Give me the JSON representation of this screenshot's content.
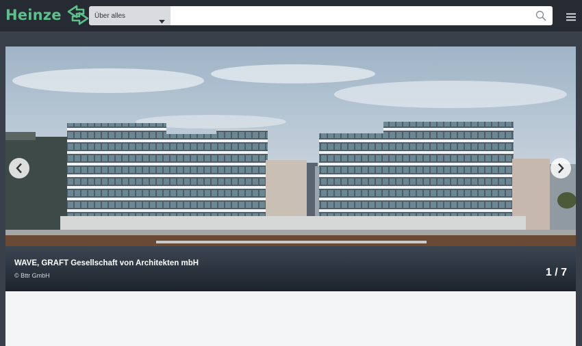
{
  "header": {
    "logo_text": "Heinze",
    "brand_color": "#5cc08a",
    "scope_select": {
      "selected": "Über alles"
    },
    "search": {
      "placeholder": "",
      "value": ""
    },
    "icons": [
      "heinze-logo-mark-icon",
      "chevron-down-icon",
      "search-icon",
      "hamburger-menu-icon"
    ]
  },
  "slider": {
    "caption": "WAVE, GRAFT Gesellschaft von Architekten mbH",
    "credit": "© Bttr GmbH",
    "counter": "1 / 7",
    "prev_icon": "chevron-left-icon",
    "next_icon": "chevron-right-icon"
  },
  "content": {
    "heading": ""
  }
}
